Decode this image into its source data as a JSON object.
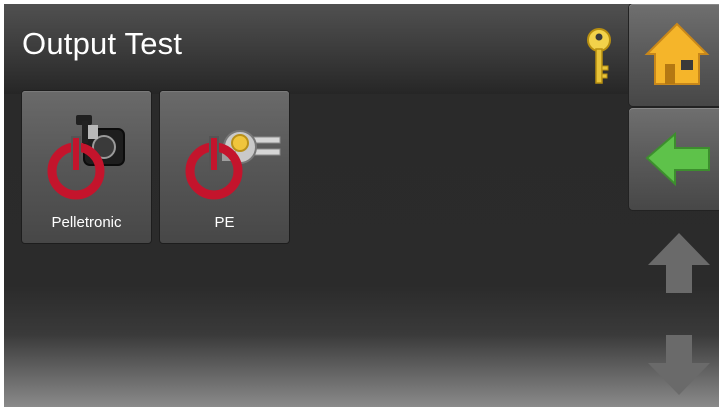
{
  "header": {
    "title": "Output Test"
  },
  "icons": {
    "key": "key-icon",
    "home": "home-icon",
    "back": "back-arrow-icon",
    "scroll_up": "up-arrow-icon",
    "scroll_down": "down-arrow-icon"
  },
  "tiles": [
    {
      "label": "Pelletronic",
      "icon": "pump-power-icon"
    },
    {
      "label": "PE",
      "icon": "valve-power-icon"
    }
  ],
  "colors": {
    "home": "#f5b52a",
    "back": "#5ec24a",
    "power_red": "#c4142c",
    "key": "#f2d24a"
  }
}
